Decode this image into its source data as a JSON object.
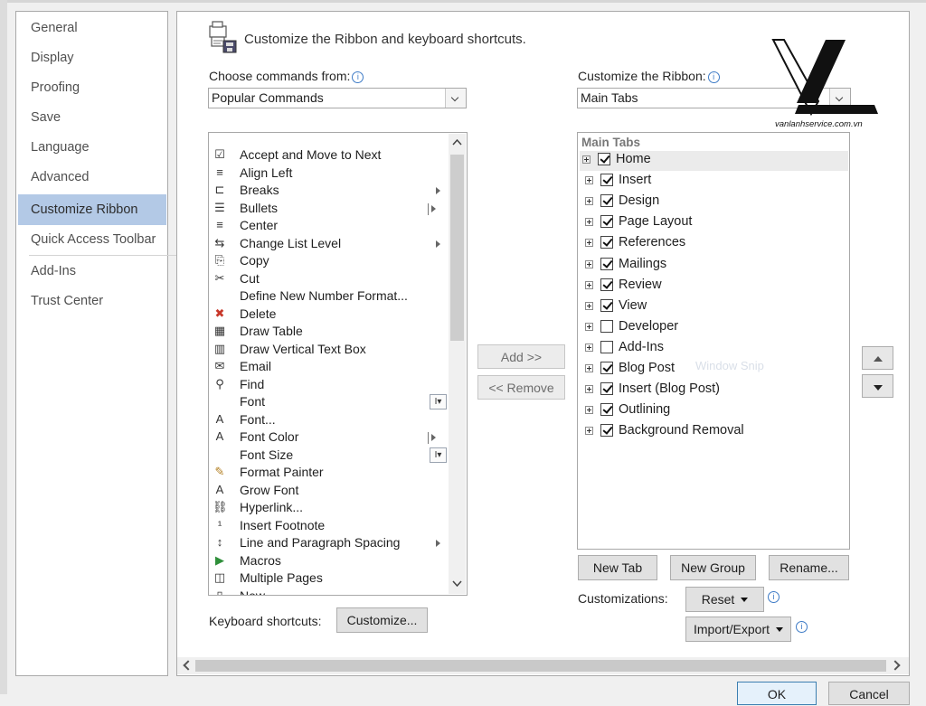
{
  "nav": {
    "items": [
      {
        "label": "General"
      },
      {
        "label": "Display"
      },
      {
        "label": "Proofing"
      },
      {
        "label": "Save"
      },
      {
        "label": "Language"
      },
      {
        "label": "Advanced"
      },
      {
        "label": "Customize Ribbon",
        "selected": true
      },
      {
        "label": "Quick Access Toolbar"
      },
      {
        "label": "Add-Ins"
      },
      {
        "label": "Trust Center"
      }
    ]
  },
  "header": {
    "title": "Customize the Ribbon and keyboard shortcuts."
  },
  "left": {
    "choose_label": "Choose commands from:",
    "choose_value": "Popular Commands",
    "commands": [
      {
        "label": "Accept and Move to Next",
        "icon": "accept-icon"
      },
      {
        "label": "Align Left",
        "icon": "align-left-icon"
      },
      {
        "label": "Breaks",
        "icon": "breaks-icon",
        "sub": true
      },
      {
        "label": "Bullets",
        "icon": "bullets-icon",
        "subbar": true
      },
      {
        "label": "Center",
        "icon": "center-icon"
      },
      {
        "label": "Change List Level",
        "icon": "list-level-icon",
        "sub": true
      },
      {
        "label": "Copy",
        "icon": "copy-icon"
      },
      {
        "label": "Cut",
        "icon": "cut-icon"
      },
      {
        "label": "Define New Number Format...",
        "icon": ""
      },
      {
        "label": "Delete",
        "icon": "delete-icon"
      },
      {
        "label": "Draw Table",
        "icon": "draw-table-icon"
      },
      {
        "label": "Draw Vertical Text Box",
        "icon": "vertical-textbox-icon"
      },
      {
        "label": "Email",
        "icon": "email-icon"
      },
      {
        "label": "Find",
        "icon": "find-icon"
      },
      {
        "label": "Font",
        "icon": "",
        "ibox": true
      },
      {
        "label": "Font...",
        "icon": "font-dialog-icon"
      },
      {
        "label": "Font Color",
        "icon": "font-color-icon",
        "subbar": true
      },
      {
        "label": "Font Size",
        "icon": "",
        "ibox": true
      },
      {
        "label": "Format Painter",
        "icon": "format-painter-icon"
      },
      {
        "label": "Grow Font",
        "icon": "grow-font-icon"
      },
      {
        "label": "Hyperlink...",
        "icon": "hyperlink-icon"
      },
      {
        "label": "Insert Footnote",
        "icon": "footnote-icon"
      },
      {
        "label": "Line and Paragraph Spacing",
        "icon": "line-spacing-icon",
        "sub": true
      },
      {
        "label": "Macros",
        "icon": "macros-icon"
      },
      {
        "label": "Multiple Pages",
        "icon": "multiple-pages-icon"
      },
      {
        "label": "New",
        "icon": "new-document-icon"
      }
    ]
  },
  "right": {
    "customize_label": "Customize the Ribbon:",
    "customize_value": "Main Tabs",
    "tree_header": "Main Tabs",
    "tabs": [
      {
        "label": "Home",
        "checked": true,
        "selected": true
      },
      {
        "label": "Insert",
        "checked": true
      },
      {
        "label": "Design",
        "checked": true
      },
      {
        "label": "Page Layout",
        "checked": true
      },
      {
        "label": "References",
        "checked": true
      },
      {
        "label": "Mailings",
        "checked": true
      },
      {
        "label": "Review",
        "checked": true
      },
      {
        "label": "View",
        "checked": true
      },
      {
        "label": "Developer",
        "checked": false
      },
      {
        "label": "Add-Ins",
        "checked": false
      },
      {
        "label": "Blog Post",
        "checked": true
      },
      {
        "label": "Insert (Blog Post)",
        "checked": true
      },
      {
        "label": "Outlining",
        "checked": true
      },
      {
        "label": "Background Removal",
        "checked": true
      }
    ],
    "watermark": "Window Snip"
  },
  "buttons": {
    "add": "Add >>",
    "remove": "<< Remove",
    "new_tab": "New Tab",
    "new_group": "New Group",
    "rename": "Rename...",
    "customizations_label": "Customizations:",
    "reset": "Reset",
    "import_export": "Import/Export",
    "keyboard_label": "Keyboard shortcuts:",
    "customize": "Customize...",
    "ok": "OK",
    "cancel": "Cancel"
  },
  "logo": {
    "url": "vanlanhservice.com.vn"
  }
}
